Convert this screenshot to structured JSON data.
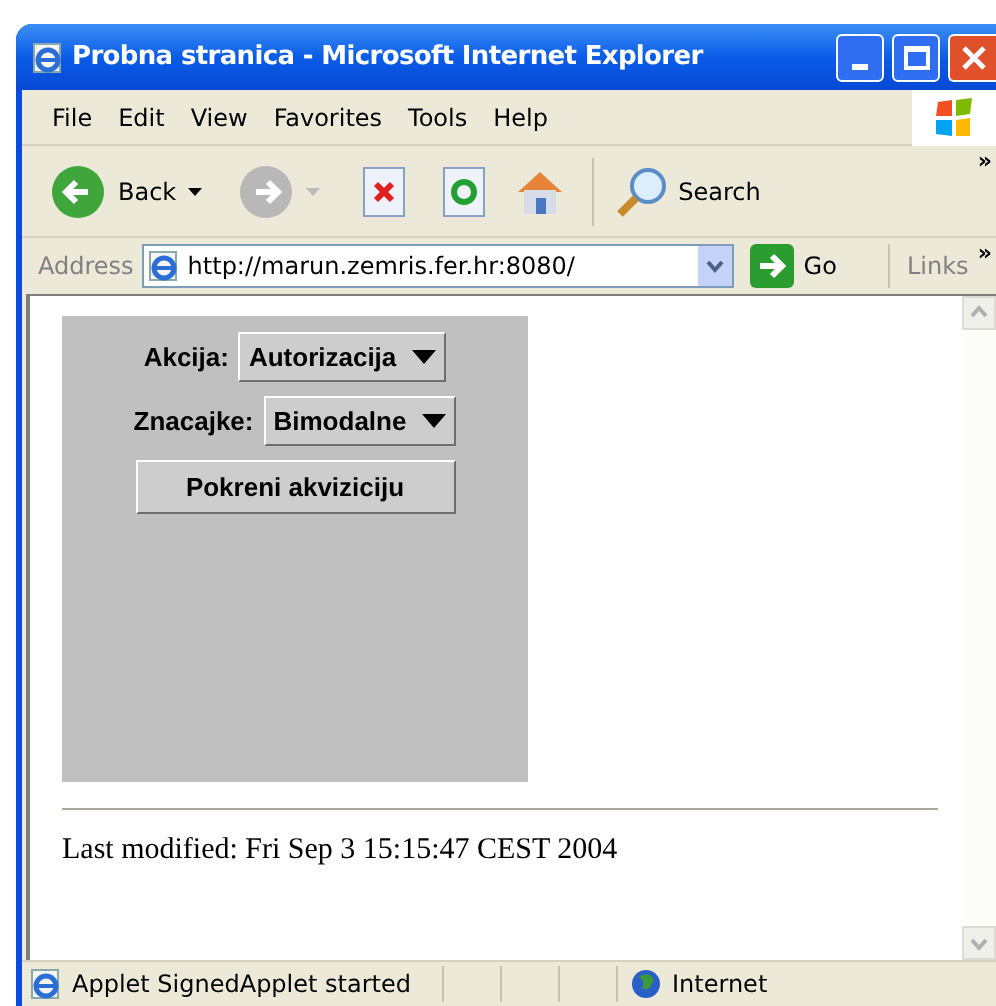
{
  "window": {
    "title": "Probna stranica - Microsoft Internet Explorer"
  },
  "menu": [
    "File",
    "Edit",
    "View",
    "Favorites",
    "Tools",
    "Help"
  ],
  "toolbar": {
    "back": "Back",
    "search": "Search",
    "overflow": "»"
  },
  "address_bar": {
    "label": "Address",
    "url": "http://marun.zemris.fer.hr:8080/",
    "go": "Go",
    "links": "Links",
    "overflow": "»"
  },
  "applet": {
    "fields": [
      {
        "label": "Akcija:",
        "value": "Autorizacija"
      },
      {
        "label": "Znacajke:",
        "value": "Bimodalne"
      }
    ],
    "button": "Pokreni akviziciju"
  },
  "footer": "Last modified: Fri Sep 3 15:15:47 CEST 2004",
  "status_bar": {
    "message": "Applet SignedApplet started",
    "zone": "Internet"
  }
}
